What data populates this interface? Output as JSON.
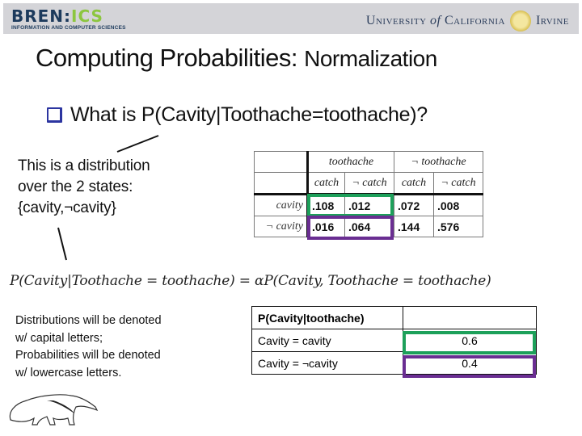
{
  "header": {
    "left_logo": {
      "main_dark": "BREN:",
      "main_green": "ICS",
      "subtitle": "INFORMATION AND COMPUTER SCIENCES"
    },
    "right_logo": {
      "text_before": "University",
      "text_of": "of",
      "text_after": "California",
      "text_end": "Irvine",
      "seal_icon": "uci-seal-icon"
    }
  },
  "slide": {
    "title_part1": "Computing Probabilities:",
    "title_part2": "Normalization",
    "bullet": "What is P(Cavity|Toothache=toothache)?",
    "note_distribution": [
      "This is a distribution",
      "over  the 2 states:",
      "{cavity,¬cavity}"
    ],
    "formula": "P(Cavity|Toothache = toothache) = αP(Cavity, Toothache = toothache)",
    "note_notation": [
      "Distributions will be denoted",
      "w/ capital letters;",
      "Probabilities will be denoted",
      "w/ lowercase letters."
    ]
  },
  "joint_table": {
    "top_headers": [
      "toothache",
      "¬ toothache"
    ],
    "sub_headers": [
      "catch",
      "¬ catch",
      "catch",
      "¬ catch"
    ],
    "rows": [
      {
        "label": "cavity",
        "values": [
          ".108",
          ".012",
          ".072",
          ".008"
        ]
      },
      {
        "label": "¬ cavity",
        "values": [
          ".016",
          ".064",
          ".144",
          ".576"
        ]
      }
    ],
    "highlight_colors": {
      "cavity_row": "#1da05a",
      "not_cavity_row": "#6a2e92"
    }
  },
  "conditional_table": {
    "header": "P(Cavity|toothache)",
    "rows": [
      {
        "label": "Cavity = cavity",
        "value": "0.6"
      },
      {
        "label": "Cavity = ¬cavity",
        "value": "0.4"
      }
    ]
  }
}
